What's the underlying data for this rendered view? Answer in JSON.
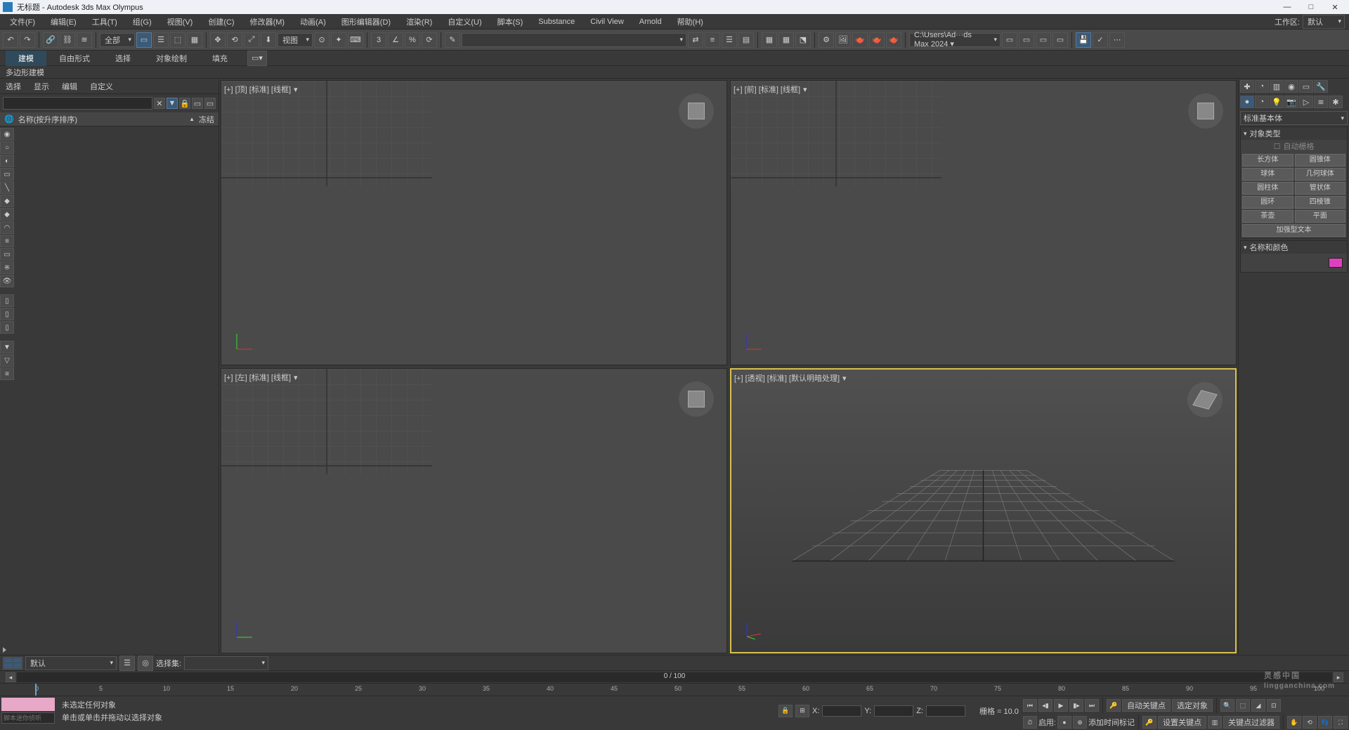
{
  "title": "无标题 - Autodesk 3ds Max Olympus",
  "menu": [
    "文件(F)",
    "编辑(E)",
    "工具(T)",
    "组(G)",
    "视图(V)",
    "创建(C)",
    "修改器(M)",
    "动画(A)",
    "图形编辑器(D)",
    "渲染(R)",
    "自定义(U)",
    "脚本(S)",
    "Substance",
    "Civil View",
    "Arnold",
    "帮助(H)"
  ],
  "workspace_label": "工作区:",
  "workspace_value": "默认",
  "toolbar": {
    "scope": "全部",
    "view": "视图",
    "path": "C:\\Users\\Ad···ds Max 2024 ▾"
  },
  "ribbon": {
    "tabs": [
      "建模",
      "自由形式",
      "选择",
      "对象绘制",
      "填充"
    ],
    "sub": "多边形建模"
  },
  "scene": {
    "tabs": [
      "选择",
      "显示",
      "编辑",
      "自定义"
    ],
    "header_name": "名称(按升序排序)",
    "header_freeze": "冻结",
    "search_placeholder": ""
  },
  "viewports": {
    "top": "[+] [顶] [标准] [线框]",
    "front": "[+] [前] [标准] [线框]",
    "left": "[+] [左] [标准] [线框]",
    "persp": "[+] [透视] [标准] [默认明暗处理]"
  },
  "cmd": {
    "dropdown": "标准基本体",
    "rollout_type": "对象类型",
    "autogrid": "自动栅格",
    "objects": [
      "长方体",
      "圆锥体",
      "球体",
      "几何球体",
      "圆柱体",
      "管状体",
      "圆环",
      "四棱锥",
      "茶壶",
      "平面",
      "加强型文本"
    ],
    "rollout_name": "名称和颜色"
  },
  "bottom": {
    "selection_set": "选择集:",
    "default": "默认",
    "frame": "0  /  100"
  },
  "ticks": [
    "0",
    "5",
    "10",
    "15",
    "20",
    "25",
    "30",
    "35",
    "40",
    "45",
    "50",
    "55",
    "60",
    "65",
    "70",
    "75",
    "80",
    "85",
    "90",
    "95",
    "100"
  ],
  "status": {
    "script_placeholder": "脚本迷你侦听",
    "msg1": "未选定任何对象",
    "msg2": "单击或单击并拖动以选择对象",
    "x": "X:",
    "y": "Y:",
    "z": "Z:",
    "grid": "栅格 = 10.0",
    "enable": "启用:",
    "addtime": "添加时间标记",
    "autokey": "自动关键点",
    "selobj": "选定对象",
    "setkey": "设置关键点",
    "keyfilter": "关键点过滤器"
  },
  "watermark": {
    "cn": "灵感中国",
    "en": "lingganchina.com"
  }
}
